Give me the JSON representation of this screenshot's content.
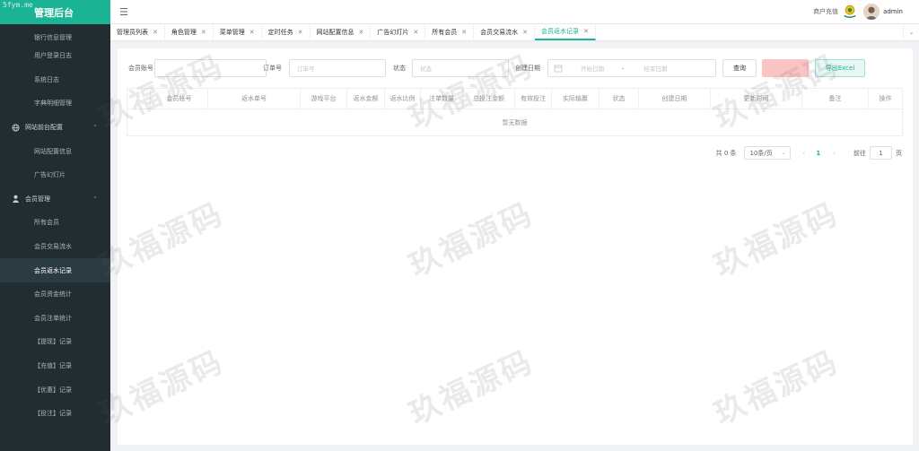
{
  "app": {
    "title": "管理后台",
    "corner_watermark": "5fym.me"
  },
  "sidebar": {
    "items": [
      {
        "label": "银行信息管理",
        "type": "item",
        "partial": true
      },
      {
        "label": "用户登录日志",
        "type": "item"
      },
      {
        "label": "系统日志",
        "type": "item"
      },
      {
        "label": "字典明细管理",
        "type": "item"
      },
      {
        "label": "网站前台配置",
        "type": "group",
        "icon": "globe-icon"
      },
      {
        "label": "网站配置信息",
        "type": "item"
      },
      {
        "label": "广告幻灯片",
        "type": "item"
      },
      {
        "label": "会员管理",
        "type": "group",
        "icon": "user-icon"
      },
      {
        "label": "所有会员",
        "type": "item"
      },
      {
        "label": "会员交易流水",
        "type": "item"
      },
      {
        "label": "会员返水记录",
        "type": "item",
        "active": true
      },
      {
        "label": "会员资金统计",
        "type": "item"
      },
      {
        "label": "会员注单统计",
        "type": "item"
      },
      {
        "label": "【提现】记录",
        "type": "item"
      },
      {
        "label": "【充值】记录",
        "type": "item"
      },
      {
        "label": "【优惠】记录",
        "type": "item"
      },
      {
        "label": "【投注】记录",
        "type": "item"
      }
    ]
  },
  "header": {
    "recharge_label": "商户充值",
    "username": "admin"
  },
  "tabs": [
    {
      "label": "管理员列表"
    },
    {
      "label": "角色管理"
    },
    {
      "label": "菜单管理"
    },
    {
      "label": "定时任务"
    },
    {
      "label": "网站配置信息"
    },
    {
      "label": "广告幻灯片"
    },
    {
      "label": "所有会员"
    },
    {
      "label": "会员交易流水"
    },
    {
      "label": "会员返水记录",
      "active": true
    }
  ],
  "filters": {
    "member_account_label": "会员账号",
    "order_no_label": "订单号",
    "order_no_placeholder": "订单号",
    "status_label": "状态",
    "status_placeholder": "状态",
    "created_date_label": "创建日期",
    "start_date_placeholder": "开始日期",
    "range_separator": "-",
    "end_date_placeholder": "结束日期",
    "query_button": "查询",
    "export_button": "导出Excel"
  },
  "table": {
    "columns": [
      "",
      "会员帐号",
      "返水单号",
      "游戏平台",
      "返水金额",
      "返水比例",
      "注单数量",
      "总投注金额",
      "有效投注",
      "实际输赢",
      "状态",
      "创建日期",
      "更新时间",
      "备注",
      "操作"
    ],
    "empty_text": "暂无数据"
  },
  "pagination": {
    "total_text": "共 0 条",
    "page_size": "10条/页",
    "current_page": "1",
    "goto_label": "前往",
    "goto_value": "1",
    "page_unit": "页"
  },
  "watermark_text": "玖福源码",
  "colors": {
    "accent": "#1ab394",
    "sidebar_bg": "#222d32",
    "danger_light": "#fbc4c4"
  }
}
